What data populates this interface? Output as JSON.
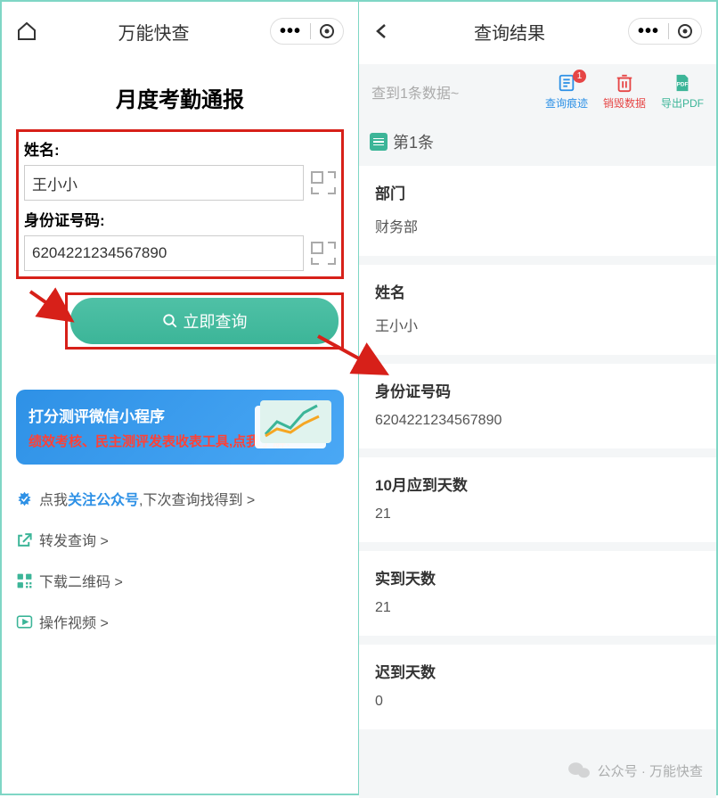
{
  "left": {
    "nav_title": "万能快查",
    "report_title": "月度考勤通报",
    "name_label": "姓名:",
    "name_value": "王小小",
    "id_label": "身份证号码:",
    "id_value": "6204221234567890",
    "submit_label": "立即查询",
    "promo": {
      "title": "打分测评微信小程序",
      "subtitle_red": "绩效考核、民主测评发表收表工具,点我了解!"
    },
    "links": {
      "follow_pre": "点我",
      "follow_highlight": "关注公众号",
      "follow_post": ",下次查询找得到 >",
      "forward": "转发查询 >",
      "qrcode": "下载二维码 >",
      "video": "操作视频 >"
    }
  },
  "right": {
    "nav_title": "查询结果",
    "result_hint": "查到1条数据~",
    "actions": {
      "trace": "查询痕迹",
      "trace_badge": "1",
      "destroy": "销毁数据",
      "export": "导出PDF"
    },
    "record_header": "第1条",
    "cards": [
      {
        "label": "部门",
        "value": "财务部"
      },
      {
        "label": "姓名",
        "value": "王小小"
      },
      {
        "label": "身份证号码",
        "value": "6204221234567890"
      },
      {
        "label": "10月应到天数",
        "value": "21"
      },
      {
        "label": "实到天数",
        "value": "21"
      },
      {
        "label": "迟到天数",
        "value": "0"
      }
    ]
  },
  "watermark": "公众号 · 万能快查"
}
